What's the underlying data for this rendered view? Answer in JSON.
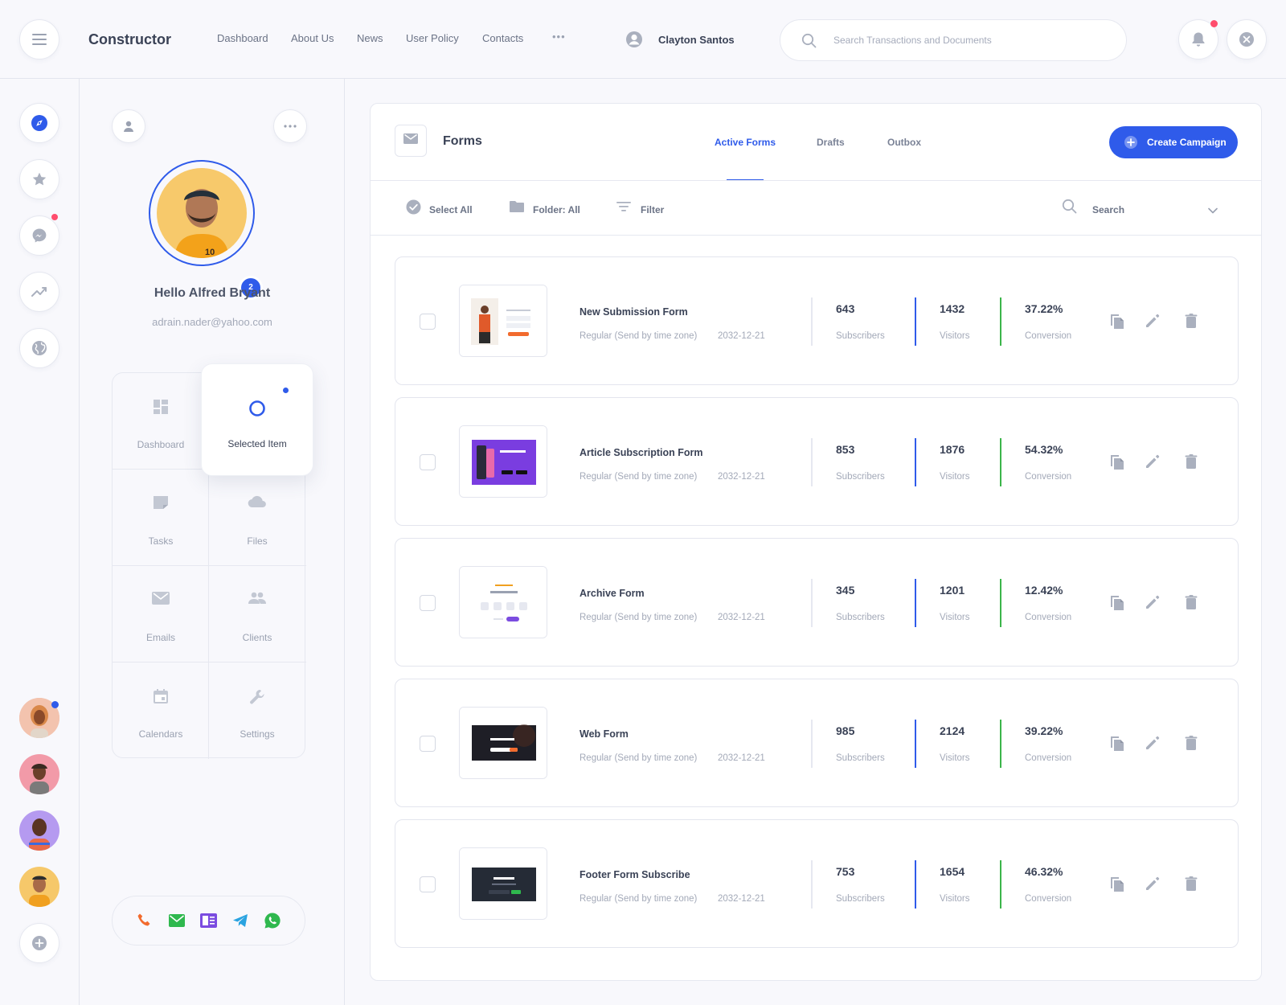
{
  "colors": {
    "accent": "#2f5bea",
    "green_divider": "#3bb54a",
    "alert_dot": "#ff4d6d"
  },
  "topbar": {
    "brand": "Constructor",
    "nav": [
      "Dashboard",
      "About Us",
      "News",
      "User Policy",
      "Contacts"
    ],
    "more": "•••",
    "user_name": "Clayton Santos",
    "search_placeholder": "Search Transactions and Documents"
  },
  "rail": {
    "icons": [
      "compass-icon",
      "star-icon",
      "messenger-icon",
      "trending-icon",
      "globe-icon"
    ],
    "add_icon": "plus-icon"
  },
  "profile": {
    "hello": "Hello Alfred Bryant",
    "email": "adrain.nader@yahoo.com",
    "badge": "2",
    "menu": [
      {
        "label": "Dashboard",
        "icon": "dashboard-icon"
      },
      {
        "label": "Selected Item",
        "icon": "circle-icon"
      },
      {
        "label": "Tasks",
        "icon": "note-icon"
      },
      {
        "label": "Files",
        "icon": "cloud-icon"
      },
      {
        "label": "Emails",
        "icon": "mail-icon"
      },
      {
        "label": "Clients",
        "icon": "people-icon"
      },
      {
        "label": "Calendars",
        "icon": "calendar-icon"
      },
      {
        "label": "Settings",
        "icon": "wrench-icon"
      }
    ],
    "contacts": [
      "phone-icon",
      "mail-icon",
      "newspaper-icon",
      "telegram-icon",
      "whatsapp-icon"
    ]
  },
  "forms_panel": {
    "title": "Forms",
    "tabs": [
      "Active Forms",
      "Drafts",
      "Outbox"
    ],
    "create_label": "Create Campaign",
    "toolbar": {
      "select_all": "Select All",
      "folder": "Folder: All",
      "filter": "Filter",
      "search": "Search"
    }
  },
  "rows": [
    {
      "name": "New Submission Form",
      "meta": "Regular (Send by time zone)",
      "date": "2032-12-21",
      "subscribers": "643",
      "visitors": "1432",
      "conversion": "37.22%"
    },
    {
      "name": "Article Subscription Form",
      "meta": "Regular (Send by time zone)",
      "date": "2032-12-21",
      "subscribers": "853",
      "visitors": "1876",
      "conversion": "54.32%"
    },
    {
      "name": "Archive Form",
      "meta": "Regular (Send by time zone)",
      "date": "2032-12-21",
      "subscribers": "345",
      "visitors": "1201",
      "conversion": "12.42%"
    },
    {
      "name": "Web Form",
      "meta": "Regular (Send by time zone)",
      "date": "2032-12-21",
      "subscribers": "985",
      "visitors": "2124",
      "conversion": "39.22%"
    },
    {
      "name": "Footer Form Subscribe",
      "meta": "Regular (Send by time zone)",
      "date": "2032-12-21",
      "subscribers": "753",
      "visitors": "1654",
      "conversion": "46.32%"
    }
  ],
  "labels": {
    "subscribers": "Subscribers",
    "visitors": "Visitors",
    "conversion": "Conversion"
  }
}
